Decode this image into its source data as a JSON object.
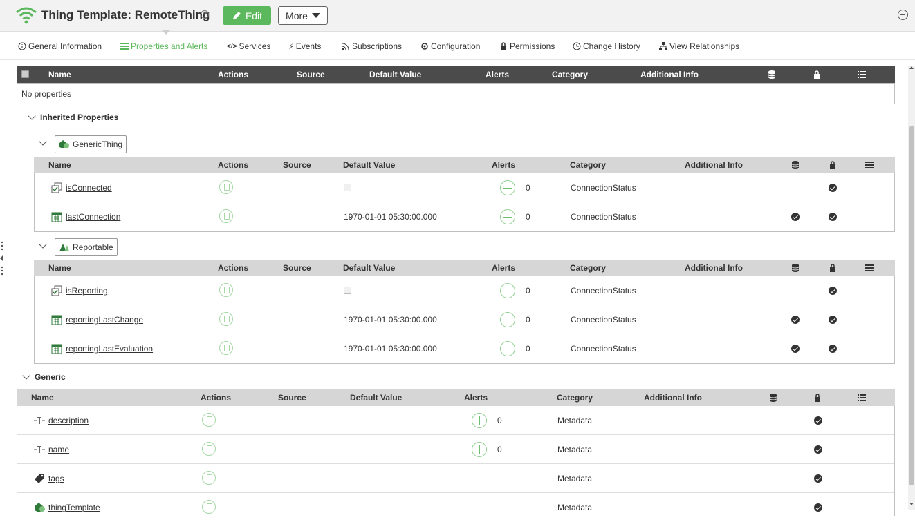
{
  "header": {
    "title": "Thing Template: RemoteThing",
    "help_glyph": "?",
    "edit_label": "Edit",
    "more_label": "More",
    "accent_color": "#5cb85c"
  },
  "tabs": [
    {
      "label": "General Information",
      "icon": "info-icon"
    },
    {
      "label": "Properties and Alerts",
      "icon": "list-icon",
      "active": true
    },
    {
      "label": "Services",
      "icon": "code-icon"
    },
    {
      "label": "Events",
      "icon": "bolt-icon"
    },
    {
      "label": "Subscriptions",
      "icon": "rss-icon"
    },
    {
      "label": "Configuration",
      "icon": "gear-icon"
    },
    {
      "label": "Permissions",
      "icon": "lock-icon"
    },
    {
      "label": "Change History",
      "icon": "clock-icon"
    },
    {
      "label": "View Relationships",
      "icon": "hierarchy-icon"
    }
  ],
  "columns": {
    "name": "Name",
    "actions": "Actions",
    "source": "Source",
    "default_value": "Default Value",
    "alerts": "Alerts",
    "category": "Category",
    "additional_info": "Additional Info"
  },
  "own_properties": {
    "empty_text": "No properties"
  },
  "inherited": {
    "title": "Inherited Properties",
    "groups": [
      {
        "name": "GenericThing",
        "rows": [
          {
            "name": "isConnected",
            "type_icon": "boolean-icon",
            "default": "",
            "default_checkbox": true,
            "alerts": "0",
            "category": "ConnectionStatus",
            "persistent": false,
            "read_only": true
          },
          {
            "name": "lastConnection",
            "type_icon": "datetime-icon",
            "default": "1970-01-01 05:30:00.000",
            "alerts": "0",
            "category": "ConnectionStatus",
            "persistent": true,
            "read_only": true
          }
        ]
      },
      {
        "name": "Reportable",
        "rows": [
          {
            "name": "isReporting",
            "type_icon": "boolean-icon",
            "default": "",
            "default_checkbox": true,
            "alerts": "0",
            "category": "ConnectionStatus",
            "persistent": false,
            "read_only": true
          },
          {
            "name": "reportingLastChange",
            "type_icon": "datetime-icon",
            "default": "1970-01-01 05:30:00.000",
            "alerts": "0",
            "category": "ConnectionStatus",
            "persistent": true,
            "read_only": true
          },
          {
            "name": "reportingLastEvaluation",
            "type_icon": "datetime-icon",
            "default": "1970-01-01 05:30:00.000",
            "alerts": "0",
            "category": "ConnectionStatus",
            "persistent": true,
            "read_only": true
          }
        ]
      }
    ]
  },
  "generic": {
    "title": "Generic",
    "rows": [
      {
        "name": "description",
        "type_icon": "string-icon",
        "alerts": "0",
        "category": "Metadata",
        "read_only": true
      },
      {
        "name": "name",
        "type_icon": "string-icon",
        "alerts": "0",
        "category": "Metadata",
        "read_only": true
      },
      {
        "name": "tags",
        "type_icon": "tag-icon",
        "alerts": "",
        "category": "Metadata",
        "read_only": true
      },
      {
        "name": "thingTemplate",
        "type_icon": "thingtemplate-icon",
        "alerts": "",
        "category": "Metadata",
        "read_only": true
      }
    ]
  }
}
